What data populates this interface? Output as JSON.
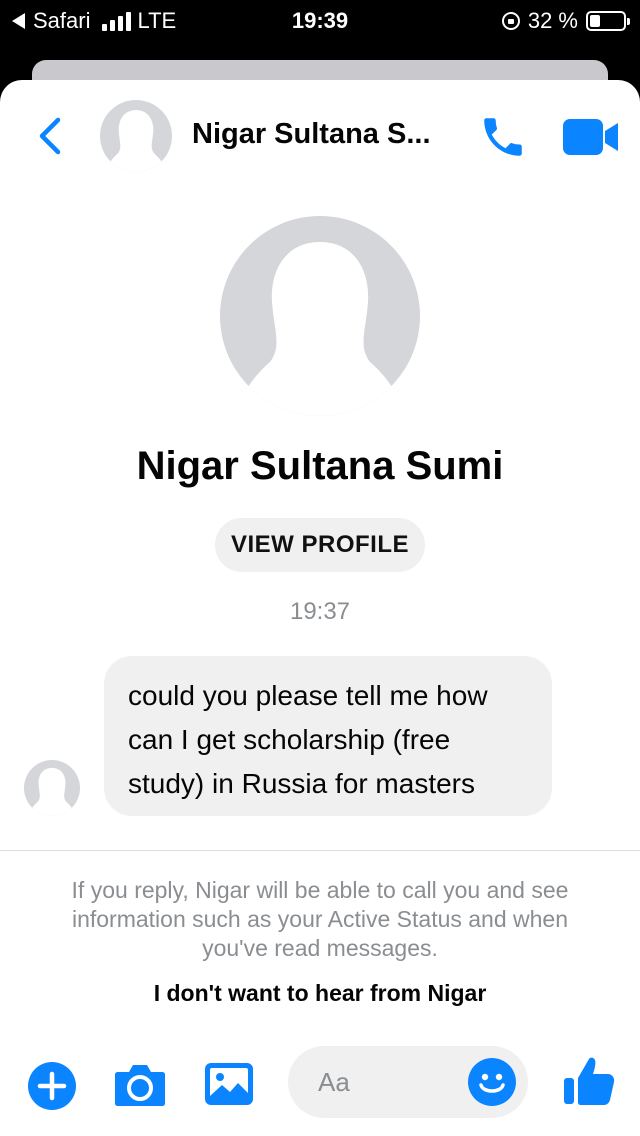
{
  "status_bar": {
    "back_app": "Safari",
    "network": "LTE",
    "time": "19:39",
    "battery": "32 %",
    "battery_level": 0.32
  },
  "header": {
    "contact_name": "Nigar Sultana S..."
  },
  "profile": {
    "name": "Nigar Sultana Sumi",
    "view_profile_label": "VIEW PROFILE"
  },
  "conversation": {
    "timestamp": "19:37",
    "messages": [
      {
        "sender": "Nigar Sultana Sumi",
        "text": "could you please tell me how can I get scholarship (free study) in Russia for masters"
      }
    ]
  },
  "request_notice": {
    "text": "If you reply, Nigar will be able to call you and see information such as your Active Status and when you've read messages.",
    "block_label": "I don't want to hear from Nigar"
  },
  "composer": {
    "placeholder": "Aa"
  },
  "colors": {
    "accent": "#0a84ff",
    "bubble": "#f0f0f0",
    "avatar_bg": "#d4d6da"
  }
}
